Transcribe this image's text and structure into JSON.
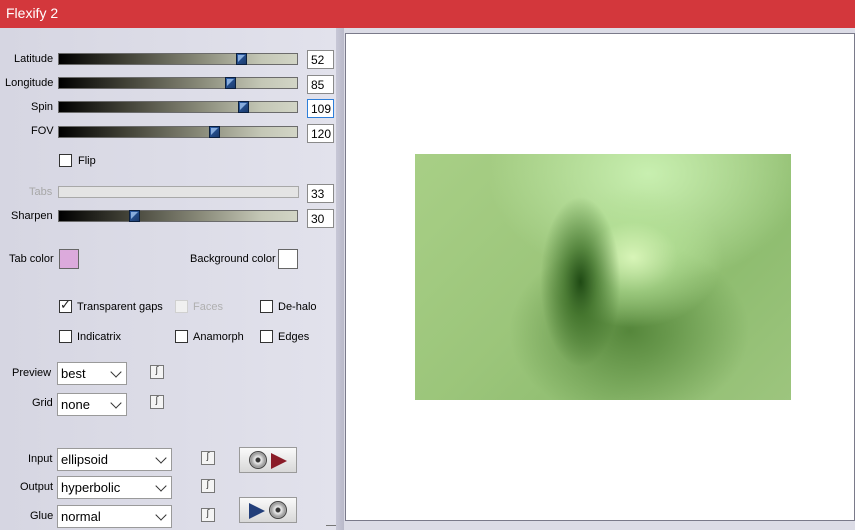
{
  "window": {
    "title": "Flexify 2"
  },
  "sliders": [
    {
      "id": "latitude",
      "label": "Latitude",
      "value": "52",
      "fraction": 0.78,
      "disabled": false,
      "focused": false
    },
    {
      "id": "longitude",
      "label": "Longitude",
      "value": "85",
      "fraction": 0.73,
      "disabled": false,
      "focused": false
    },
    {
      "id": "spin",
      "label": "Spin",
      "value": "109",
      "fraction": 0.79,
      "disabled": false,
      "focused": true
    },
    {
      "id": "fov",
      "label": "FOV",
      "value": "120",
      "fraction": 0.66,
      "disabled": false,
      "focused": false
    },
    {
      "id": "tabs",
      "label": "Tabs",
      "value": "33",
      "fraction": null,
      "disabled": true,
      "focused": false
    },
    {
      "id": "sharpen",
      "label": "Sharpen",
      "value": "30",
      "fraction": 0.31,
      "disabled": false,
      "focused": false
    }
  ],
  "flip": {
    "label": "Flip",
    "checked": false
  },
  "colors": {
    "tab_color_label": "Tab color",
    "tab_color": "#dcaadc",
    "background_color_label": "Background color",
    "background_color": "#ffffff"
  },
  "options": {
    "transparent_gaps": {
      "label": "Transparent gaps",
      "checked": true,
      "disabled": false
    },
    "faces": {
      "label": "Faces",
      "checked": false,
      "disabled": true
    },
    "de_halo": {
      "label": "De-halo",
      "checked": false,
      "disabled": false
    },
    "indicatrix": {
      "label": "Indicatrix",
      "checked": false,
      "disabled": false
    },
    "anamorph": {
      "label": "Anamorph",
      "checked": false,
      "disabled": false
    },
    "edges": {
      "label": "Edges",
      "checked": false,
      "disabled": false
    }
  },
  "preview": {
    "label": "Preview",
    "value": "best"
  },
  "grid": {
    "label": "Grid",
    "value": "none"
  },
  "input": {
    "label": "Input",
    "value": "ellipsoid"
  },
  "output": {
    "label": "Output",
    "value": "hyperbolic"
  },
  "glue": {
    "label": "Glue",
    "value": "normal"
  },
  "link_glyph": "ʃ",
  "accent_colors": {
    "titlebar": "#d3373c",
    "thumb": "#2c5ea8"
  }
}
